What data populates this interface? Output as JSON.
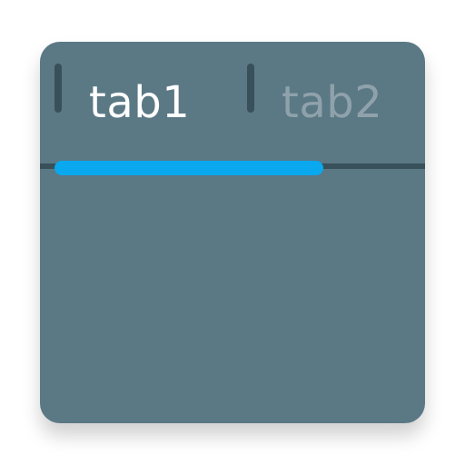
{
  "tabs": {
    "items": [
      {
        "label": "tab1",
        "active": true
      },
      {
        "label": "tab2",
        "active": false
      }
    ]
  },
  "colors": {
    "panel": "#5b7885",
    "active_text": "#ffffff",
    "inactive_text": "#8fa2ab",
    "indicator": "#0aa8ef",
    "divider": "#38505a"
  }
}
